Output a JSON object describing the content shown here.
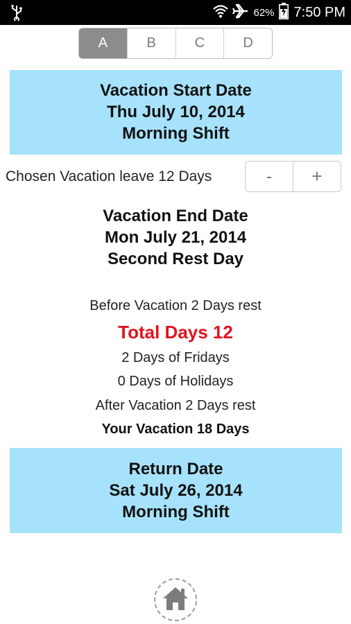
{
  "status_bar": {
    "battery_percent": "62%",
    "time": "7:50 PM",
    "icons": [
      "usb-icon",
      "wifi-icon",
      "airplane-icon",
      "battery-charging-icon"
    ]
  },
  "tabs": [
    {
      "label": "A",
      "active": true
    },
    {
      "label": "B",
      "active": false
    },
    {
      "label": "C",
      "active": false
    },
    {
      "label": "D",
      "active": false
    }
  ],
  "start": {
    "title": "Vacation Start Date",
    "date": "Thu July 10, 2014",
    "shift": "Morning Shift"
  },
  "chosen": {
    "text": "Chosen Vacation leave 12 Days",
    "minus": "-",
    "plus": "+"
  },
  "end": {
    "title": "Vacation End Date",
    "date": "Mon July 21, 2014",
    "shift": "Second Rest Day"
  },
  "summary": {
    "before": "Before Vacation 2 Days rest",
    "total": "Total Days 12",
    "fridays": "2 Days of Fridays",
    "holidays": "0 Days of Holidays",
    "after": "After Vacation 2 Days rest",
    "your_vacation": "Your Vacation 18 Days"
  },
  "return": {
    "title": "Return Date",
    "date": "Sat July 26, 2014",
    "shift": "Morning Shift"
  },
  "colors": {
    "box_blue": "#a6e2fb",
    "total_red": "#e0141e",
    "tab_active": "#8c8c8c"
  }
}
